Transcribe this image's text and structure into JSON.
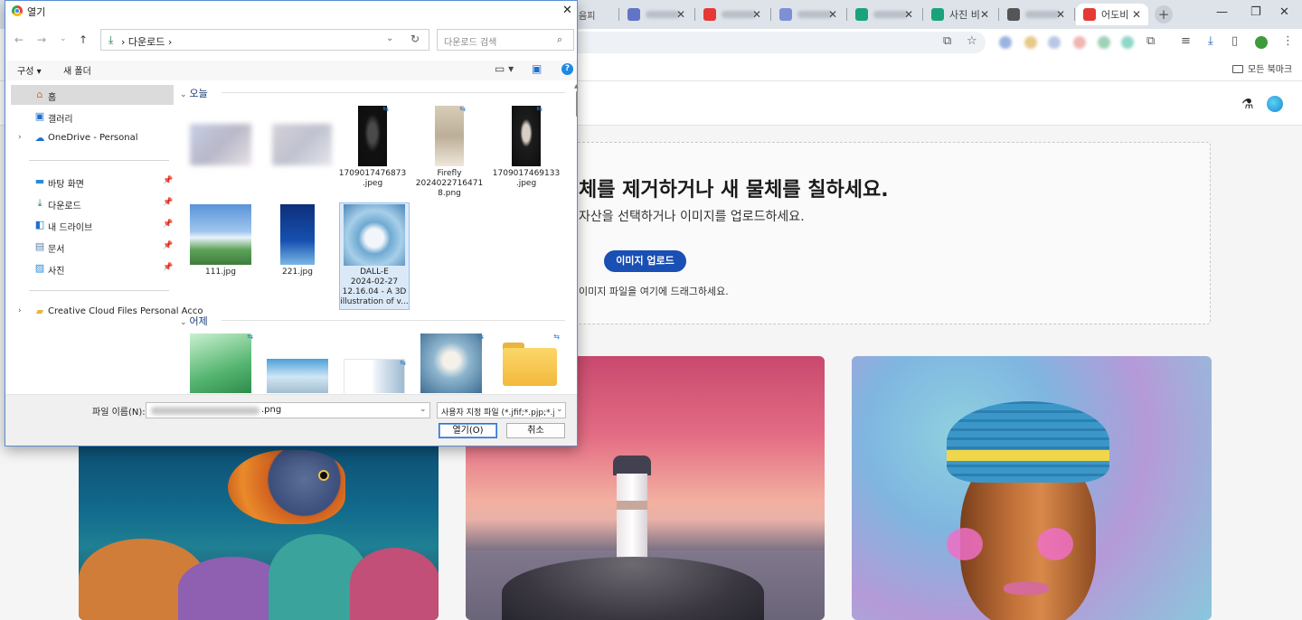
{
  "browser": {
    "tabs": [
      {
        "label": "",
        "fav_color": "#7c8bd1"
      },
      {
        "label": "",
        "fav_color": "#6274c6"
      },
      {
        "label": "",
        "fav_color": "#e53935"
      },
      {
        "label": "",
        "fav_color": "#7e8fd6"
      },
      {
        "label": "",
        "fav_color": "#1aa37a"
      },
      {
        "label": "사진 비",
        "fav_color": "#1aa37a"
      },
      {
        "label": "",
        "fav_color": "#555555"
      },
      {
        "label": "어도비",
        "fav_color": "#e53935"
      }
    ],
    "partial_tab_label": "음피",
    "bookmarks_all": "모든 북마크"
  },
  "page": {
    "title": "체를 제거하거나 새 물체를 칠하세요.",
    "subtitle": "자산을 선택하거나 이미지를 업로드하세요.",
    "upload_button": "이미지 업로드",
    "drag_hint": "이미지 파일을 여기에 드래그하세요."
  },
  "dialog": {
    "title": "열기",
    "path": [
      "다운로드"
    ],
    "search_placeholder": "다운로드 검색",
    "commands": {
      "organize": "구성",
      "new_folder": "새 폴더"
    },
    "nav_items": [
      {
        "label": "홈",
        "icon": "home-icon",
        "selected": true
      },
      {
        "label": "갤러리",
        "icon": "gallery-icon"
      },
      {
        "label": "OneDrive - Personal",
        "icon": "onedrive-icon",
        "expandable": true
      },
      {
        "label": "바탕 화면",
        "icon": "desktop-icon",
        "pinned": true
      },
      {
        "label": "다운로드",
        "icon": "download-icon",
        "pinned": true
      },
      {
        "label": "내 드라이브",
        "icon": "drive-icon",
        "pinned": true
      },
      {
        "label": "문서",
        "icon": "documents-icon",
        "pinned": true
      },
      {
        "label": "사진",
        "icon": "pictures-icon",
        "pinned": true
      },
      {
        "label": "Creative Cloud Files Personal Acco",
        "icon": "folder-icon",
        "expandable": true
      }
    ],
    "groups": {
      "today": "오늘",
      "yesterday": "어제"
    },
    "files_today": [
      {
        "name": "",
        "kind": "blurred"
      },
      {
        "name": "",
        "kind": "blurred"
      },
      {
        "name": "1709017476873\n.jpeg",
        "kind": "dark-portrait"
      },
      {
        "name": "Firefly\n2024022716471\n8.png",
        "kind": "light-portrait"
      },
      {
        "name": "1709017469133\n.jpeg",
        "kind": "dark-portrait"
      },
      {
        "name": "111.jpg",
        "kind": "sky"
      },
      {
        "name": "221.jpg",
        "kind": "blue-poster"
      },
      {
        "name": "DALL-E\n2024-02-27\n12.16.04 - A 3D\nillustration of v...",
        "kind": "dalle",
        "selected": true
      }
    ],
    "files_yesterday": [
      {
        "kind": "green"
      },
      {
        "kind": "church"
      },
      {
        "kind": "white"
      },
      {
        "kind": "church-snow"
      },
      {
        "kind": "folder"
      }
    ],
    "filename_label": "파일 이름(N):",
    "filename_ext": ".png",
    "filetype": "사용자 지정 파일 (*.jfif;*.pjp;*.j",
    "open_button": "열기(O)",
    "cancel_button": "취소"
  }
}
